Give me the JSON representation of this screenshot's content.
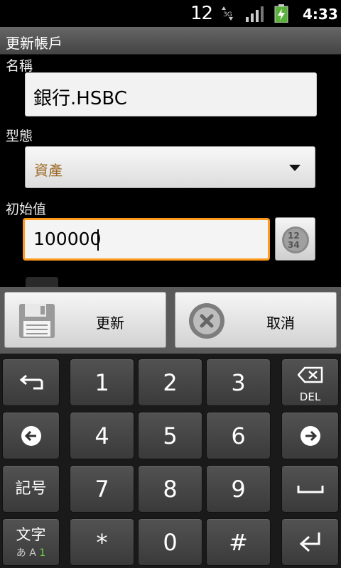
{
  "status_bar": {
    "notification_count": "12",
    "time": "4:33"
  },
  "title_bar": {
    "title": "更新帳戶"
  },
  "form": {
    "name_label": "名稱",
    "name_value": "銀行.HSBC",
    "type_label": "型態",
    "type_value": "資產",
    "initial_label": "初始值",
    "initial_value": "100000"
  },
  "actions": {
    "update_label": "更新",
    "cancel_label": "取消"
  },
  "keyboard": {
    "row1": {
      "k1": "1",
      "k2": "2",
      "k3": "3",
      "del": "DEL"
    },
    "row2": {
      "k1": "4",
      "k2": "5",
      "k3": "6"
    },
    "row3": {
      "symbol": "記号",
      "k1": "7",
      "k2": "8",
      "k3": "9"
    },
    "row4": {
      "char": "文字",
      "mode_a": "あ",
      "mode_b": "A",
      "mode_c": "1",
      "k1": "*",
      "k2": "0",
      "k3": "#"
    }
  },
  "colors": {
    "accent_orange": "#ff9a1a",
    "type_text": "#9c6a28"
  }
}
